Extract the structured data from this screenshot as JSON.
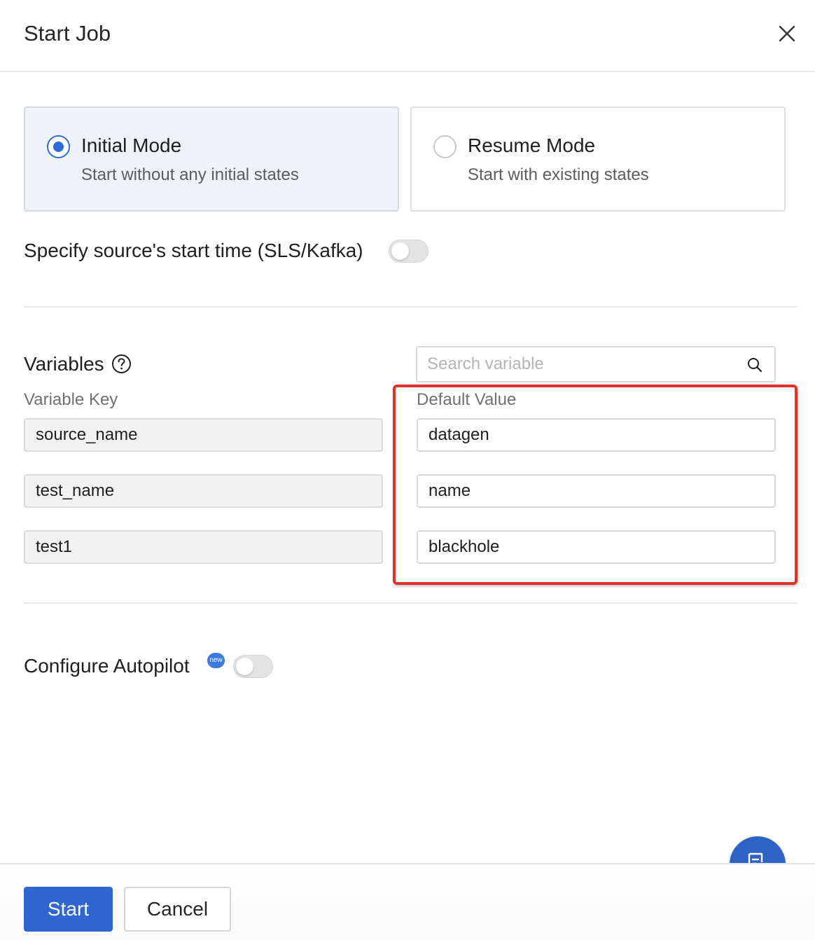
{
  "dialog": {
    "title": "Start Job"
  },
  "modes": {
    "initial": {
      "title": "Initial Mode",
      "description": "Start without any initial states",
      "selected": true
    },
    "resume": {
      "title": "Resume Mode",
      "description": "Start with existing states",
      "selected": false
    }
  },
  "source_start_time": {
    "label": "Specify source's start time (SLS/Kafka)",
    "enabled": false
  },
  "variables": {
    "title": "Variables",
    "search_placeholder": "Search variable",
    "key_header": "Variable Key",
    "value_header": "Default Value",
    "rows": [
      {
        "key": "source_name",
        "value": "datagen"
      },
      {
        "key": "test_name",
        "value": "name"
      },
      {
        "key": "test1",
        "value": "blackhole"
      }
    ]
  },
  "autopilot": {
    "label": "Configure Autopilot",
    "badge": "new",
    "enabled": false
  },
  "footer": {
    "start_label": "Start",
    "cancel_label": "Cancel"
  },
  "colors": {
    "primary": "#2f66cf",
    "highlight": "#e1322a"
  },
  "icons": [
    "close-icon",
    "help-icon",
    "search-icon",
    "document-search-icon"
  ]
}
